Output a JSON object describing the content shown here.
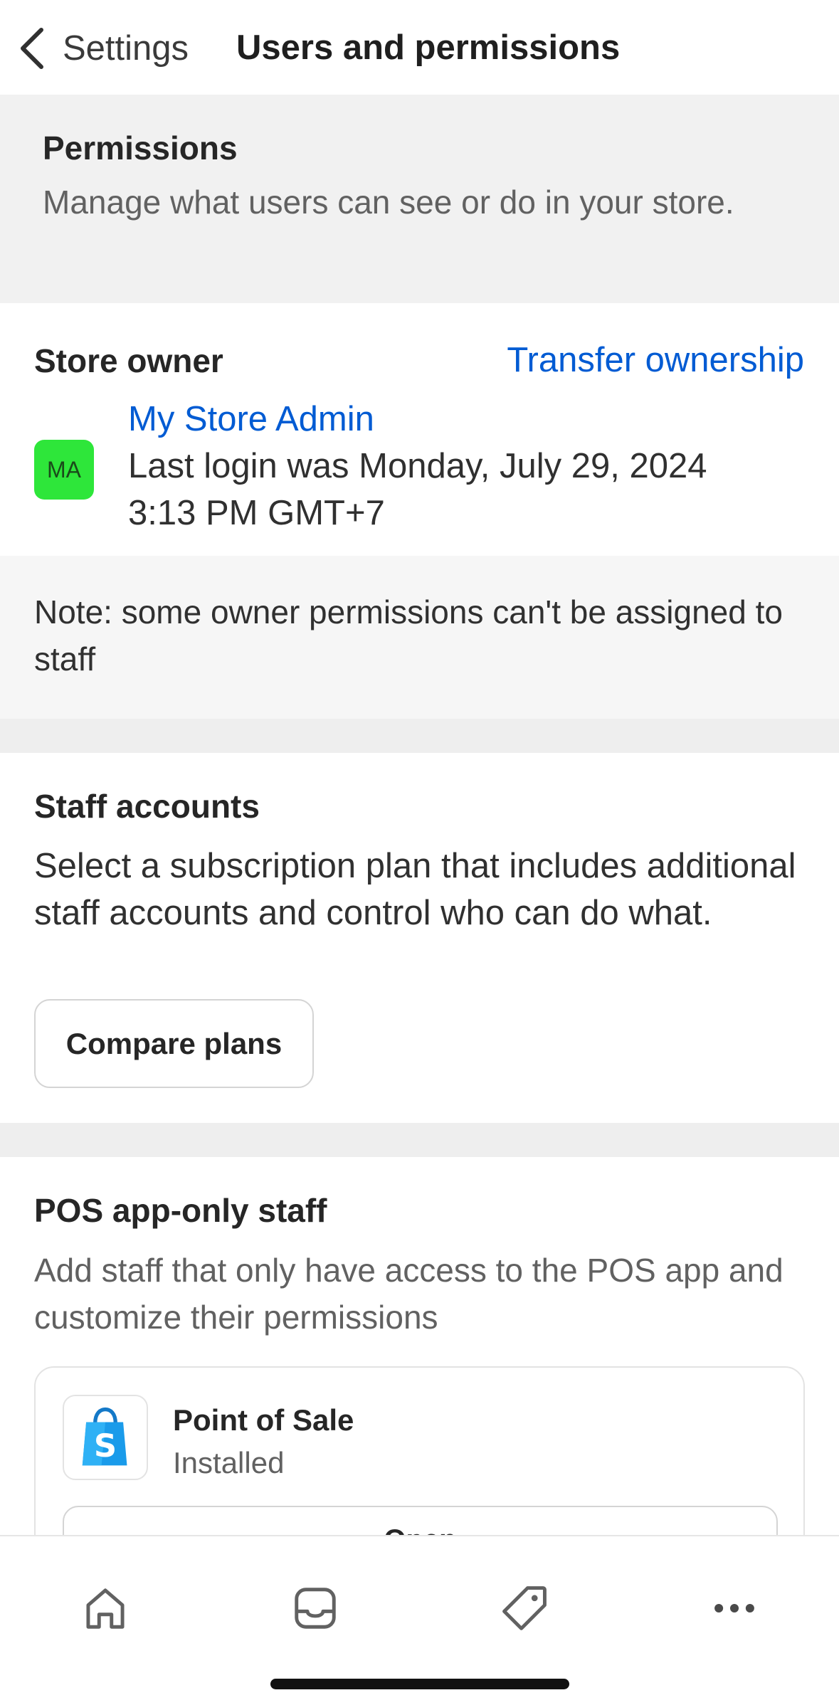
{
  "header": {
    "back_label": "Settings",
    "title": "Users and permissions"
  },
  "permissions": {
    "title": "Permissions",
    "description": "Manage what users can see or do in your store."
  },
  "store_owner": {
    "title": "Store owner",
    "transfer_link": "Transfer ownership",
    "avatar_initials": "MA",
    "avatar_color": "#2EE63A",
    "name": "My Store Admin",
    "last_login": "Last login was Monday, July 29, 2024 3:13 PM GMT+7"
  },
  "note": {
    "text": "Note: some owner permissions can't be assigned to staff"
  },
  "staff_accounts": {
    "title": "Staff accounts",
    "description": "Select a subscription plan that includes additional staff accounts and control who can do what.",
    "compare_button": "Compare plans"
  },
  "pos_staff": {
    "title": "POS app-only staff",
    "description": "Add staff that only have access to the POS app and customize their permissions",
    "app": {
      "name": "Point of Sale",
      "status": "Installed",
      "open_button": "Open",
      "icon": "shopify-bag-icon"
    }
  },
  "bottom_nav": {
    "items": [
      {
        "icon": "home-icon"
      },
      {
        "icon": "inbox-icon"
      },
      {
        "icon": "tag-icon"
      },
      {
        "icon": "more-icon"
      }
    ]
  },
  "colors": {
    "link": "#005BD3",
    "banner_bg": "#F1F1F1",
    "note_bg": "#F6F6F6",
    "pos_blue": "#1A9BEA"
  }
}
